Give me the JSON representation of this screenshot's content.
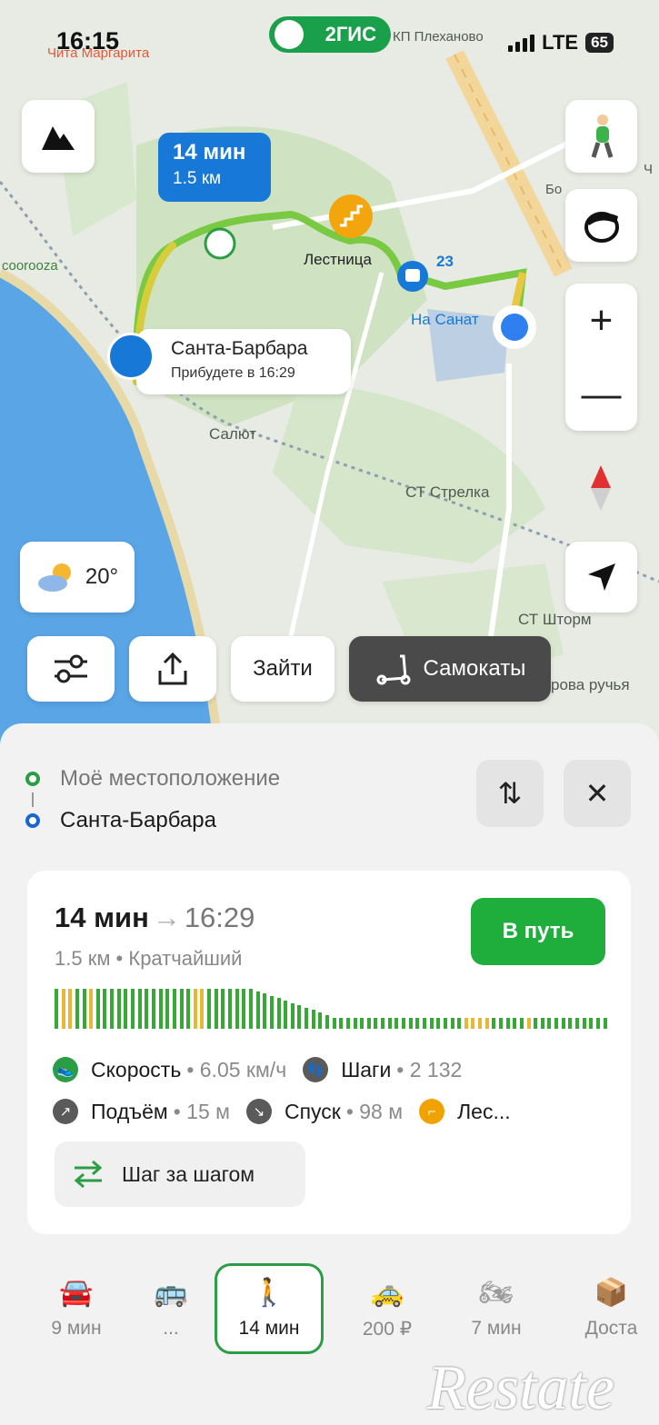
{
  "status": {
    "time": "16:15",
    "network": "LTE",
    "battery": "65",
    "app_badge": "2ГИС"
  },
  "map": {
    "labels": {
      "poi_top": "Чита Маргарита",
      "street_top": "КП Плеханово",
      "coorooza": "coorooza",
      "stairs": "Лестница",
      "bus_number": "23",
      "stop": "На Санат",
      "salut": "Салют",
      "st_strelka": "СТ Стрелка",
      "st_shtorm": "СТ Шторм",
      "ruchya": "рова ручья",
      "chi": "Ч",
      "bo": "Бо"
    },
    "route_bubble": {
      "time": "14 мин",
      "distance": "1.5 км"
    },
    "destination": {
      "name": "Санта-Барбара",
      "arrival": "Прибудете в 16:29"
    },
    "weather": {
      "temp": "20°",
      "icon": "partly-cloudy-icon"
    },
    "chips": {
      "enter": "Зайти",
      "scooters": "Самокаты"
    }
  },
  "points": {
    "from": "Моё местоположение",
    "to": "Санта-Барбара"
  },
  "route": {
    "duration": "14 мин",
    "arrival": "16:29",
    "distance_type": "1.5 км • Кратчайший",
    "go_button": "В путь",
    "stats": {
      "speed_label": "Скорость",
      "speed_value": "• 6.05 км/ч",
      "steps_label": "Шаги",
      "steps_value": "• 2 132",
      "ascent_label": "Подъём",
      "ascent_value": "• 15 м",
      "descent_label": "Спуск",
      "descent_value": "• 98 м",
      "stairs_label": "Лес..."
    },
    "step_button": "Шаг за шагом"
  },
  "modes": [
    {
      "label": "9 мин",
      "icon": "car-icon"
    },
    {
      "label": "...",
      "icon": "bus-icon"
    },
    {
      "label": "14 мин",
      "icon": "walk-icon"
    },
    {
      "label": "200 ₽",
      "icon": "taxi-icon"
    },
    {
      "label": "7 мин",
      "icon": "motorcycle-icon"
    },
    {
      "label": "Доста",
      "icon": "delivery-icon"
    }
  ],
  "watermark": "Restate",
  "colors": {
    "accent_green": "#1fae3c",
    "route_blue": "#1778d8",
    "stairs_orange": "#f0a300"
  }
}
